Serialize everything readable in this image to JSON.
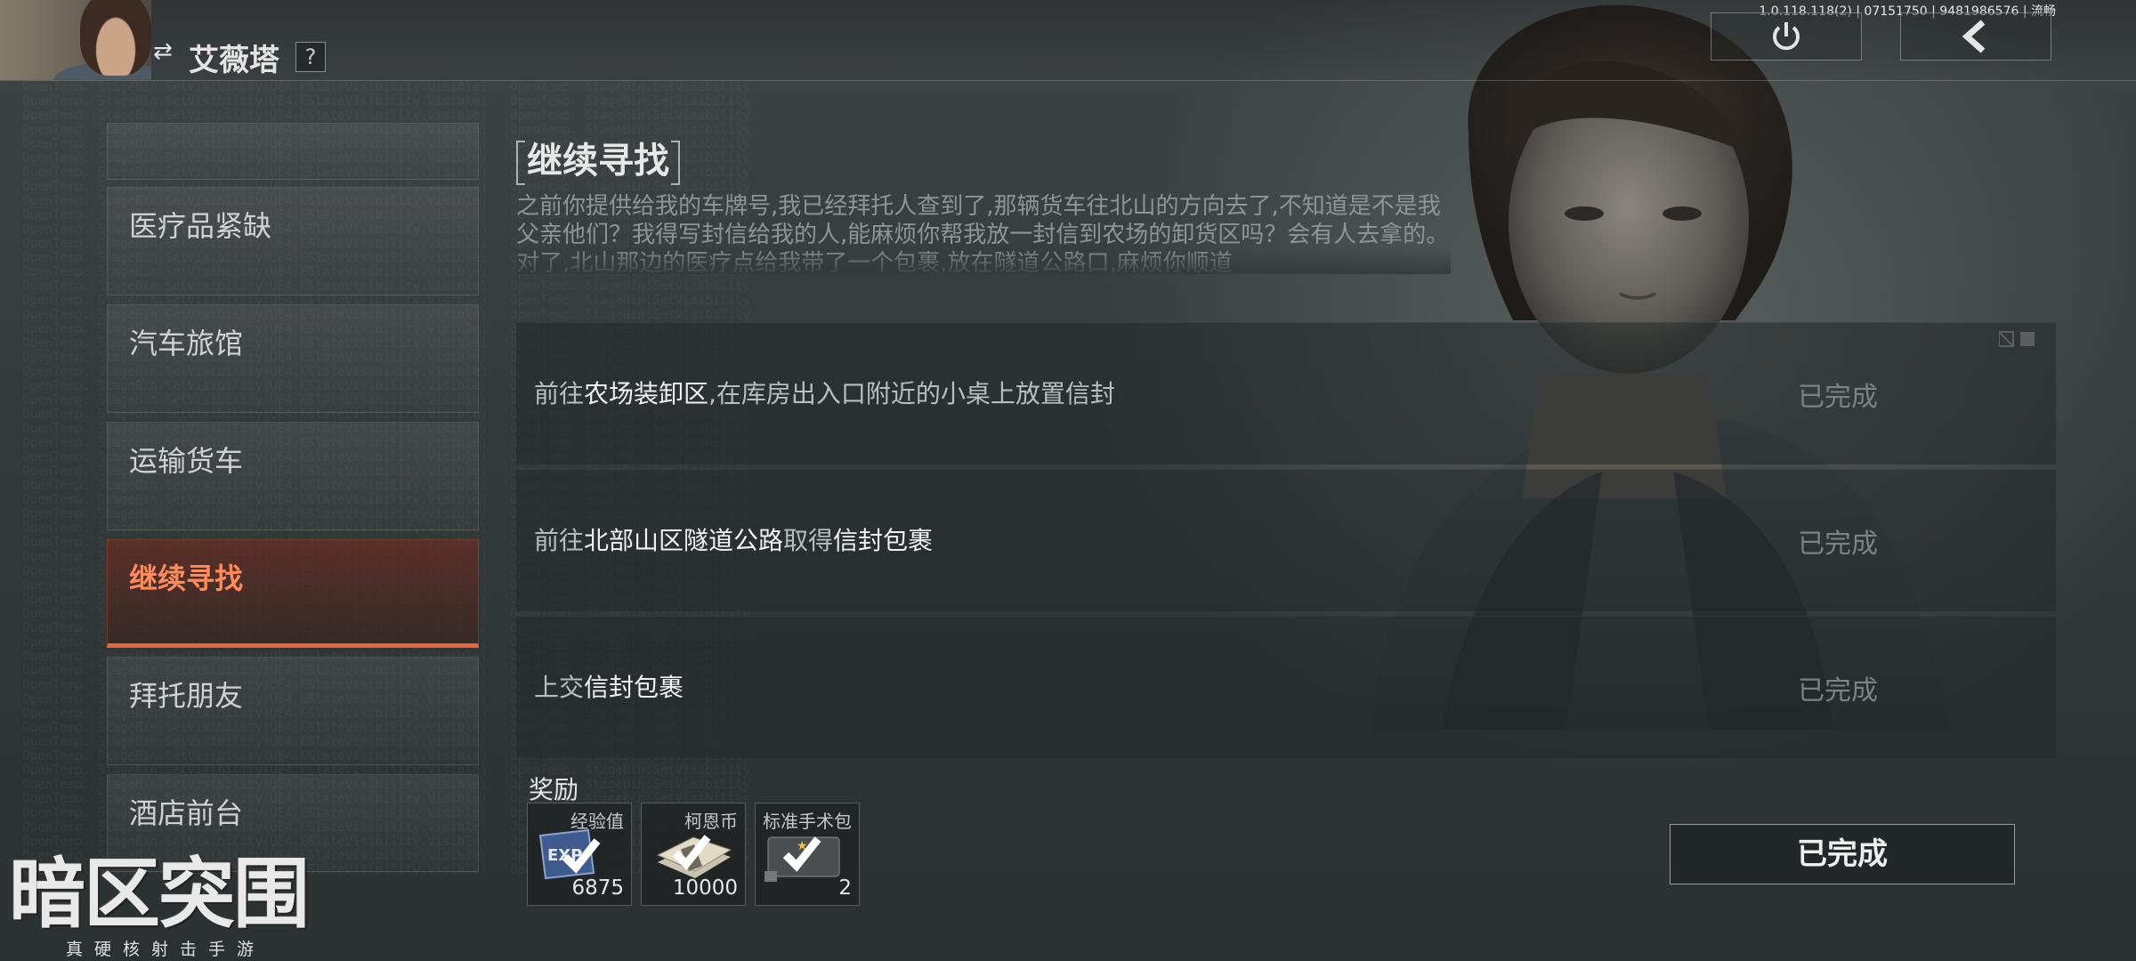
{
  "header": {
    "character_name": "艾薇塔",
    "swap_icon": "swap-icon",
    "help_label": "?",
    "version_text": "1.0.118.118(2) | 07151750 | 9481986576 | 流畅",
    "power_icon": "power-icon",
    "back_icon": "chevron-left-icon"
  },
  "sidebar": {
    "items": [
      {
        "label": "",
        "active": false
      },
      {
        "label": "医疗品紧缺",
        "active": false
      },
      {
        "label": "汽车旅馆",
        "active": false
      },
      {
        "label": "运输货车",
        "active": false
      },
      {
        "label": "继续寻找",
        "active": true
      },
      {
        "label": "拜托朋友",
        "active": false
      },
      {
        "label": "酒店前台",
        "active": false
      }
    ]
  },
  "quest": {
    "title": "继续寻找",
    "description": "之前你提供给我的车牌号,我已经拜托人查到了,那辆货车往北山的方向去了,不知道是不是我父亲他们？我得写封信给我的人,能麻烦你帮我放一封信到农场的卸货区吗？会有人去拿的。对了,北山那边的医疗点给我带了一个包裹,放在隧道公路口,麻烦你顺道"
  },
  "objectives": [
    {
      "segments": [
        {
          "t": "前往",
          "hl": false
        },
        {
          "t": "农场装卸区",
          "hl": true
        },
        {
          "t": ",在库房出入口附近的小桌上放置信封",
          "hl": false
        }
      ],
      "status": "已完成"
    },
    {
      "segments": [
        {
          "t": "前往",
          "hl": false
        },
        {
          "t": "北部山区隧道公路",
          "hl": true
        },
        {
          "t": "取得",
          "hl": false
        },
        {
          "t": "信封包裹",
          "hl": true
        }
      ],
      "status": "已完成"
    },
    {
      "segments": [
        {
          "t": "上交",
          "hl": false
        },
        {
          "t": "信封包裹",
          "hl": true
        }
      ],
      "status": "已完成"
    }
  ],
  "rewards": {
    "label": "奖励",
    "items": [
      {
        "name": "经验值",
        "count": "6875",
        "icon": "exp-ticket-icon"
      },
      {
        "name": "柯恩币",
        "count": "10000",
        "icon": "cash-stack-icon"
      },
      {
        "name": "标准手术包",
        "count": "2",
        "icon": "surgery-kit-icon"
      }
    ]
  },
  "complete_button": {
    "label": "已完成"
  },
  "logo": {
    "mark": "暗区突围",
    "slogan": "真硬核射击手游"
  }
}
